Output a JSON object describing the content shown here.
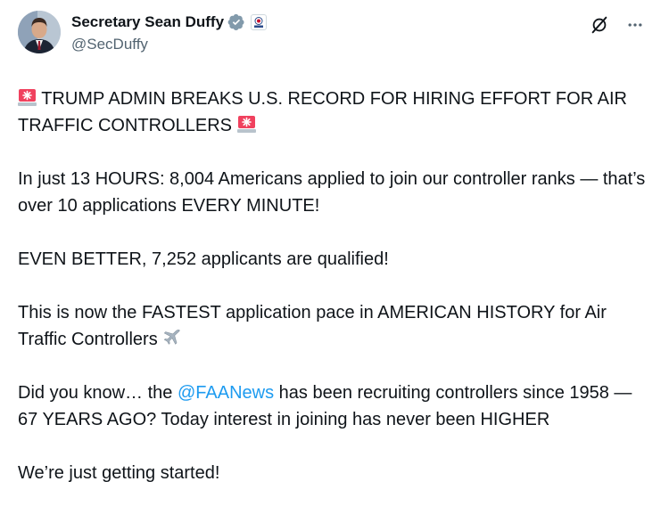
{
  "author": {
    "display_name": "Secretary Sean Duffy",
    "handle": "@SecDuffy",
    "verified_icon": "verified-badge-icon",
    "affiliation_icon": "dot-seal-icon"
  },
  "actions": {
    "grok_icon": "grok-icon",
    "more_icon": "more-horizontal-icon"
  },
  "tweet": {
    "p1": {
      "emoji_start": "police-light-emoji",
      "text": "TRUMP ADMIN BREAKS U.S. RECORD FOR HIRING EFFORT FOR AIR TRAFFIC CONTROLLERS",
      "emoji_end": "police-light-emoji"
    },
    "p2": "In just 13 HOURS: 8,004 Americans applied to join our controller ranks — that’s over 10 applications EVERY MINUTE!",
    "p3": "EVEN BETTER, 7,252 applicants are qualified!",
    "p4": {
      "text": "This is now the FASTEST application pace in AMERICAN HISTORY for Air Traffic Controllers",
      "emoji": "airplane-emoji"
    },
    "p5": {
      "before": "Did you know… the ",
      "mention": "@FAANews",
      "after": " has been recruiting controllers since 1958 —  67 YEARS AGO? Today interest in joining has never been HIGHER"
    },
    "p6": "We’re just getting started!"
  },
  "colors": {
    "text": "#0f1419",
    "secondary": "#536471",
    "link": "#1d9bf0",
    "verified": "#829aab",
    "siren": "#f0415e"
  }
}
